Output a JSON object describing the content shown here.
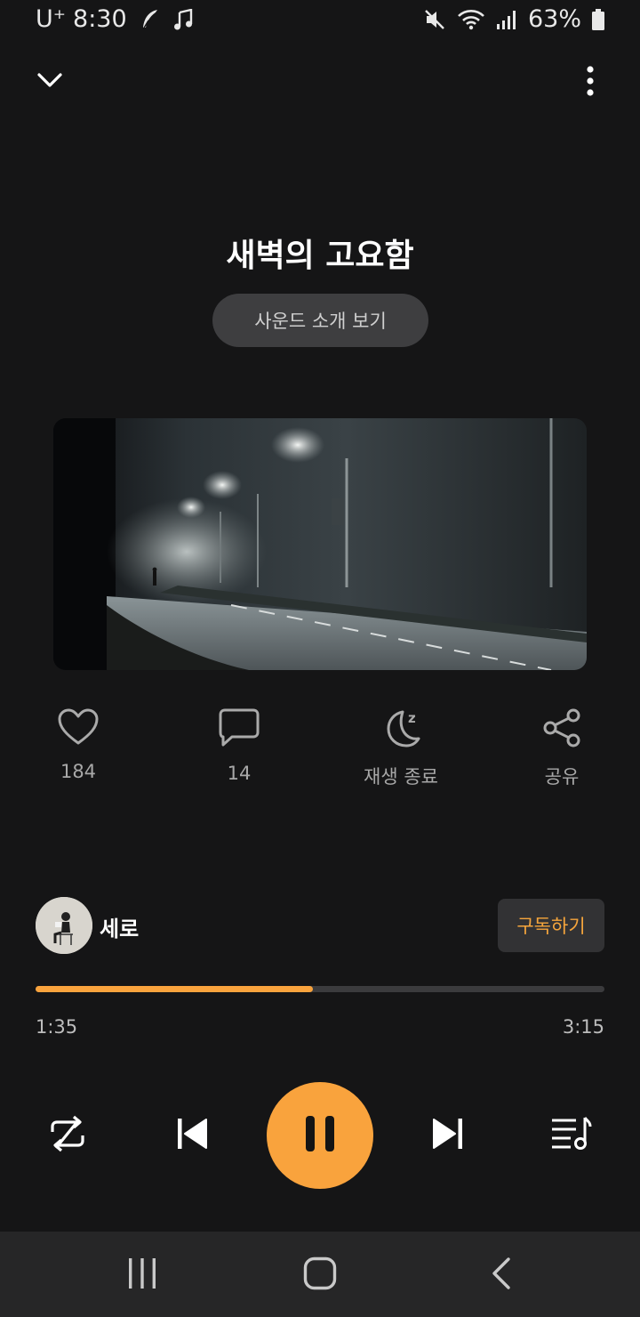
{
  "status_bar": {
    "carrier": "U⁺",
    "time": "8:30",
    "battery": "63%"
  },
  "track": {
    "title": "새벽의 고요함",
    "intro_button": "사운드 소개 보기"
  },
  "actions": {
    "likes": "184",
    "comments": "14",
    "sleep_timer": "재생 종료",
    "share": "공유"
  },
  "artist": {
    "name": "세로",
    "subscribe_label": "구독하기"
  },
  "progress": {
    "elapsed": "1:35",
    "total": "3:15",
    "fraction": 0.487
  },
  "colors": {
    "accent": "#f9a33d",
    "background": "#151516"
  },
  "icons": {
    "collapse": "chevron-down-icon",
    "menu": "more-vertical-icon",
    "like": "heart-icon",
    "comment": "comment-icon",
    "sleep": "moon-icon",
    "share": "share-icon",
    "repeat": "repeat-icon",
    "previous": "skip-previous-icon",
    "pause": "pause-icon",
    "next": "skip-next-icon",
    "playlist": "playlist-icon"
  }
}
